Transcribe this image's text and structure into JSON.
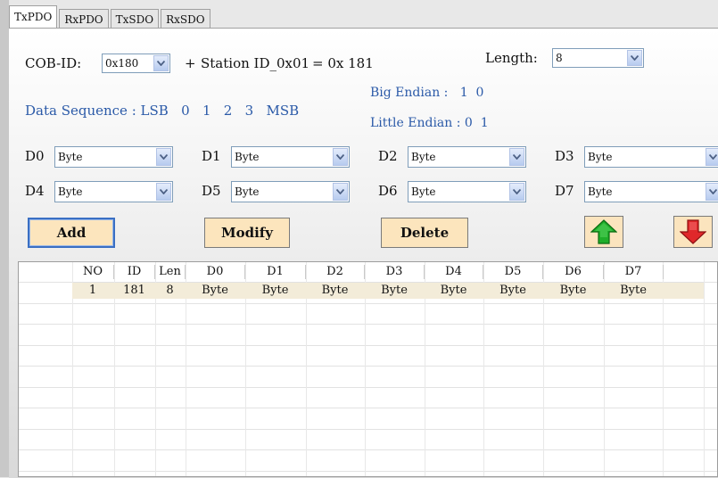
{
  "tabs": [
    "TxPDO",
    "RxPDO",
    "TxSDO",
    "RxSDO"
  ],
  "cob": {
    "label": "COB-ID:",
    "value": "0x180",
    "plus": "+",
    "station": "Station ID_0x01",
    "result": "= 0x 181"
  },
  "length": {
    "label": "Length:",
    "value": "8"
  },
  "data_sequence": "Data Sequence : LSB   0   1   2   3   MSB",
  "big_endian": "Big Endian :   1  0",
  "little_endian": "Little Endian : 0  1",
  "fields": [
    {
      "label": "D0",
      "value": "Byte"
    },
    {
      "label": "D1",
      "value": "Byte"
    },
    {
      "label": "D2",
      "value": "Byte"
    },
    {
      "label": "D3",
      "value": "Byte"
    },
    {
      "label": "D4",
      "value": "Byte"
    },
    {
      "label": "D5",
      "value": "Byte"
    },
    {
      "label": "D6",
      "value": "Byte"
    },
    {
      "label": "D7",
      "value": "Byte"
    }
  ],
  "buttons": {
    "add": "Add",
    "modify": "Modify",
    "delete": "Delete"
  },
  "table": {
    "columns": [
      "NO",
      "ID",
      "Len",
      "D0",
      "D1",
      "D2",
      "D3",
      "D4",
      "D5",
      "D6",
      "D7"
    ],
    "rows": [
      [
        "1",
        "181",
        "8",
        "Byte",
        "Byte",
        "Byte",
        "Byte",
        "Byte",
        "Byte",
        "Byte",
        "Byte"
      ]
    ]
  },
  "colors": {
    "up_arrow": "#1fae2a",
    "down_arrow": "#e0282a",
    "button_fill": "#fce5bd",
    "link_blue": "#2b5aa8"
  },
  "icons": {
    "up": "arrow-up-icon",
    "down": "arrow-down-icon",
    "dropdown": "chevron-down-icon"
  }
}
